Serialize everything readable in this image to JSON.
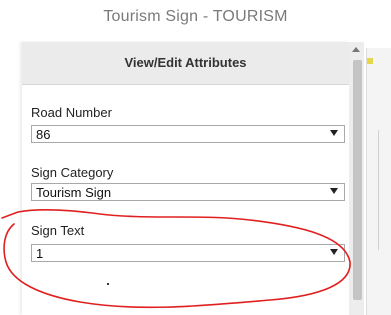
{
  "window": {
    "title": "Tourism Sign - TOURISM"
  },
  "dialog": {
    "title": "View/Edit Attributes"
  },
  "fields": {
    "road_number": {
      "label": "Road Number",
      "value": "86"
    },
    "sign_category": {
      "label": "Sign Category",
      "value": "Tourism Sign"
    },
    "sign_text": {
      "label": "Sign Text",
      "value": "1"
    }
  },
  "colors": {
    "header_bg": "#ebebeb",
    "annotation_stroke": "#e02020"
  },
  "icons": {
    "dropdown": "chevron-down-icon",
    "scroll_up": "arrow-up-icon"
  }
}
